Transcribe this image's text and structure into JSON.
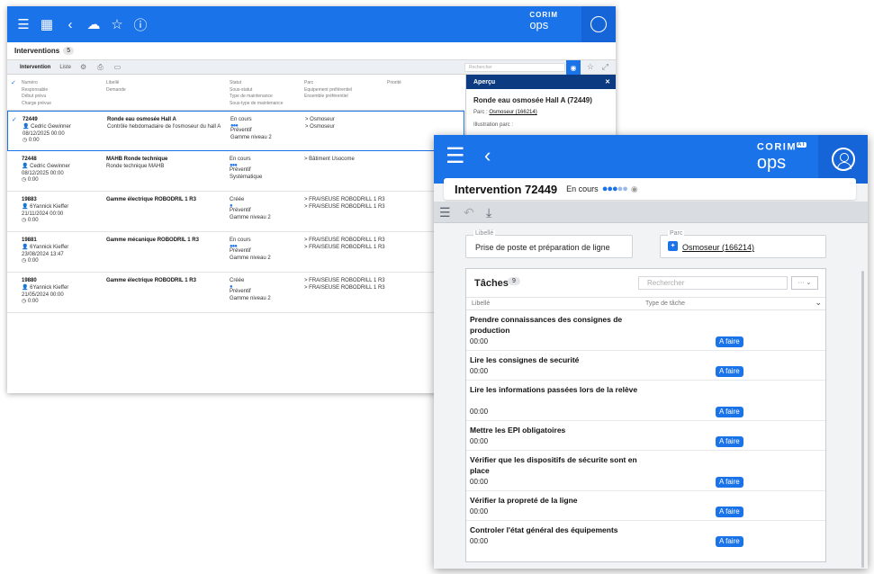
{
  "back": {
    "brand_top": "CORIM",
    "brand_app": "ops",
    "page_title": "Interventions",
    "page_count": "5",
    "toolbar": {
      "tab_intervention": "Intervention",
      "tab_liste": "Liste",
      "search_placeholder": "Rechercher"
    },
    "headers": {
      "col1": [
        "Numéro",
        "Responsable",
        "Début prévu",
        "Charge prévue"
      ],
      "col2": [
        "Libellé",
        "Demande"
      ],
      "col3": [
        "Statut",
        "Sous-statut",
        "Type de maintenance",
        "Sous-type de maintenance"
      ],
      "col4": [
        "Parc",
        "Equipement préférentiel",
        "Ensemble préférentiel"
      ],
      "col5": [
        "Priorité"
      ]
    },
    "rows": [
      {
        "num": "72449",
        "resp": "Cedric Gewinner",
        "date": "08/12/2025 00:00",
        "charge": "0:00",
        "lib": "Ronde eau osmosée Hall A",
        "dem": "Contrôle hebdomadaire de l'osmoseur du hall A",
        "st1": "En cours",
        "st2": "Préventif",
        "st3": "Gamme niveau 2",
        "parc1": "> Osmoseur",
        "parc2": "> Osmoseur"
      },
      {
        "num": "72448",
        "resp": "Cedric Gewinner",
        "date": "08/12/2025 00:00",
        "charge": "0:00",
        "lib": "MAHB Ronde technique",
        "dem": "Ronde technique MAHB",
        "st1": "En cours",
        "st2": "Préventif",
        "st3": "Systématique",
        "parc1": "> Bâtiment Usocome",
        "parc2": ""
      },
      {
        "num": "19883",
        "resp": "6Yannick Kieffer",
        "date": "21/11/2024 00:00",
        "charge": "0:00",
        "lib": "Gamme électrique ROBODRIL 1 R3",
        "dem": "",
        "st1": "Créée",
        "st2": "Préventif",
        "st3": "Gamme niveau 2",
        "parc1": "> FRAISEUSE ROBODRILL 1 R3",
        "parc2": "> FRAISEUSE ROBODRILL 1 R3"
      },
      {
        "num": "19881",
        "resp": "6Yannick Kieffer",
        "date": "23/08/2024 13:47",
        "charge": "0:00",
        "lib": "Gamme mécanique ROBODRIL 1 R3",
        "dem": "",
        "st1": "En cours",
        "st2": "Préventif",
        "st3": "Gamme niveau 2",
        "parc1": "> FRAISEUSE ROBODRILL 1 R3",
        "parc2": "> FRAISEUSE ROBODRILL 1 R3"
      },
      {
        "num": "19880",
        "resp": "6Yannick Kieffer",
        "date": "21/05/2024 00:00",
        "charge": "0:00",
        "lib": "Gamme électrique ROBODRIL 1 R3",
        "dem": "",
        "st1": "Créée",
        "st2": "Préventif",
        "st3": "Gamme niveau 2",
        "parc1": "> FRAISEUSE ROBODRILL 1 R3",
        "parc2": "> FRAISEUSE ROBODRILL 1 R3"
      }
    ],
    "preview": {
      "header": "Aperçu",
      "title": "Ronde eau osmosée Hall A (72449)",
      "parc_label": "Parc",
      "parc_value": "Osmoseur (166214)",
      "illus": "Illustration parc :"
    }
  },
  "front": {
    "brand_top": "CORIM",
    "brand_sup": "AI",
    "brand_app": "ops",
    "title": "Intervention 72449",
    "status": "En cours",
    "libelle_label": "Libellé",
    "libelle_value": "Prise de poste et préparation de ligne",
    "parc_label": "Parc",
    "parc_value": "Osmoseur (166214)",
    "tasks_title": "Tâches",
    "tasks_count": "9",
    "search_placeholder": "Rechercher",
    "col_libelle": "Libellé",
    "col_type": "Type de tâche",
    "tasks": [
      {
        "name": "Prendre connaissances des consignes de production",
        "time": "00:00",
        "status": "A faire"
      },
      {
        "name": "Lire les consignes de securité",
        "time": "00:00",
        "status": "A faire"
      },
      {
        "name": "Lire les informations passées lors de la relève",
        "time": "00:00",
        "status": "A faire"
      },
      {
        "name": "Mettre les EPI obligatoires",
        "time": "00:00",
        "status": "A faire"
      },
      {
        "name": "Vérifier que les dispositifs de sécurite sont en place",
        "time": "00:00",
        "status": "A faire"
      },
      {
        "name": "Vérifier la propreté de la ligne",
        "time": "00:00",
        "status": "A faire"
      },
      {
        "name": "Controler l'état général des équipements",
        "time": "00:00",
        "status": "A faire"
      }
    ]
  }
}
